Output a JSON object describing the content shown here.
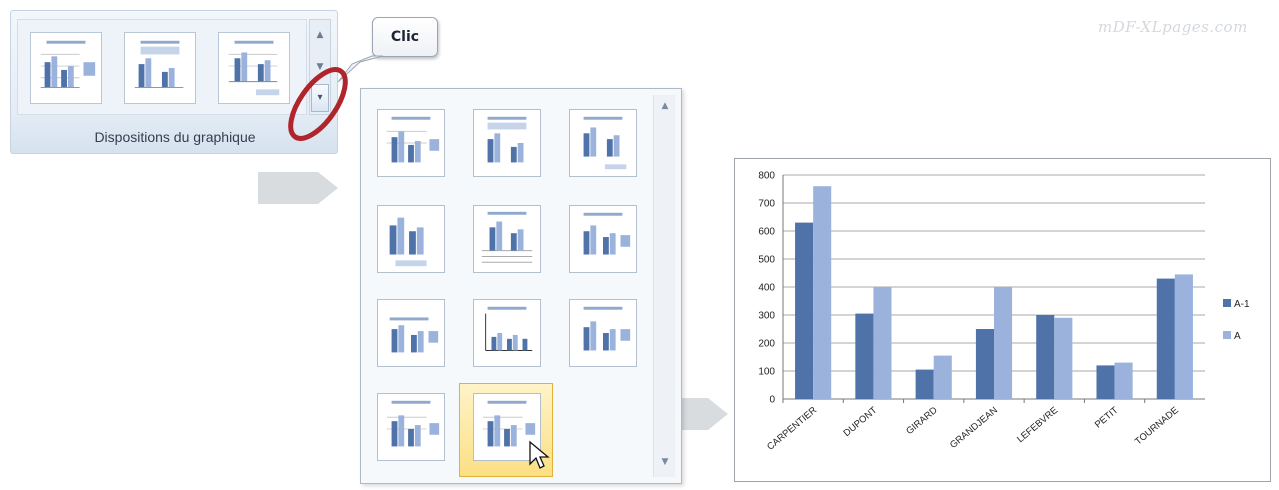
{
  "watermark": "mDF-XLpages.com",
  "ribbon": {
    "group_label": "Dispositions du graphique"
  },
  "callout": {
    "text": "Clic"
  },
  "colors": {
    "series_a1": "#4f72a8",
    "series_a": "#9bb3dc",
    "highlight_circle": "#b0242b",
    "selection": "#f4ce5f"
  },
  "gallery": {
    "layout_count": 11,
    "selected_index": 10
  },
  "chart_data": {
    "type": "bar",
    "categories": [
      "CARPENTIER",
      "DUPONT",
      "GIRARD",
      "GRANDJEAN",
      "LEFEBVRE",
      "PETIT",
      "TOURNADE"
    ],
    "series": [
      {
        "name": "A-1",
        "values": [
          630,
          305,
          105,
          250,
          300,
          120,
          430
        ]
      },
      {
        "name": "A",
        "values": [
          760,
          400,
          155,
          400,
          290,
          130,
          445
        ]
      }
    ],
    "yticks": [
      "0",
      "100",
      "200",
      "300",
      "400",
      "500",
      "600",
      "700",
      "800"
    ],
    "ylim": [
      0,
      800
    ],
    "grid": true,
    "legend": "right"
  }
}
